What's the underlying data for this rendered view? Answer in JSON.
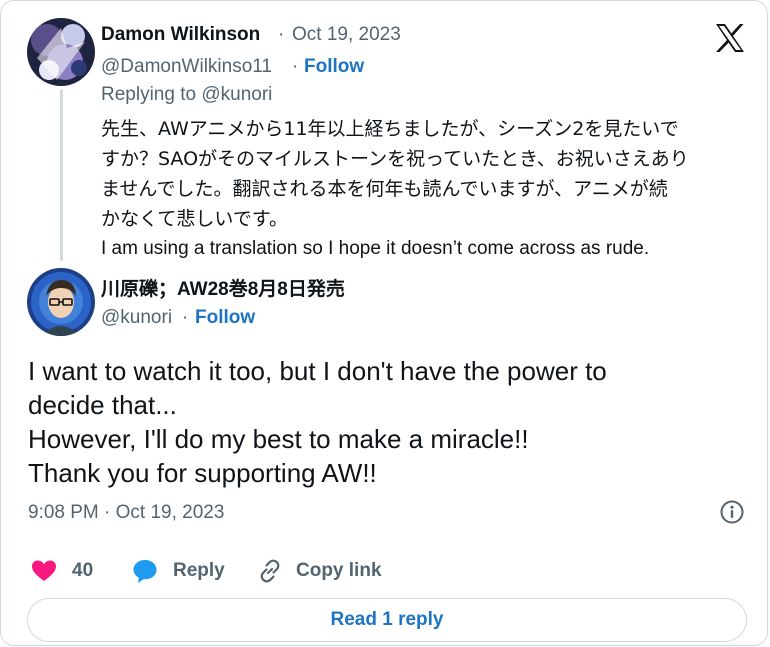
{
  "reply_tweet": {
    "author_name": "Damon Wilkinson",
    "separator": "·",
    "date": "Oct 19, 2023",
    "handle": "@DamonWilkinso11",
    "follow_label": "Follow",
    "replying_to": "Replying to @kunori",
    "text_lines": [
      "先生、AWアニメから11年以上経ちましたが、シーズン2を見たいで",
      "すか？SAOがそのマイルストーンを祝っていたとき、お祝いさえあり",
      "ませんでした。翻訳される本を何年も読んでいますが、アニメが続",
      "かなくて悲しいです。",
      "I am using a translation so I hope it doesn’t come across as rude."
    ]
  },
  "main_tweet": {
    "author_name": "川原礫；AW28巻8月8日発売",
    "handle": "@kunori",
    "separator": "·",
    "follow_label": "Follow",
    "text_lines": [
      "I want to watch it too, but I don't have the power to",
      "decide that...",
      "However, I'll do my best to make a miracle!!",
      "Thank you for supporting AW!!"
    ],
    "timestamp": "9:08 PM · Oct 19, 2023"
  },
  "actions": {
    "like_count": "40",
    "reply_label": "Reply",
    "copy_link_label": "Copy link"
  },
  "read_replies_label": "Read 1 reply",
  "icons": {
    "logo": "x-logo-icon",
    "info": "info-icon",
    "like": "heart-icon",
    "reply": "speech-bubble-icon",
    "copy_link": "link-icon"
  },
  "colors": {
    "link_blue": "#1d73c4",
    "heart_pink": "#f91880",
    "reply_blue": "#1d9bf0",
    "muted_gray": "#536471",
    "border": "#cfd9de"
  }
}
